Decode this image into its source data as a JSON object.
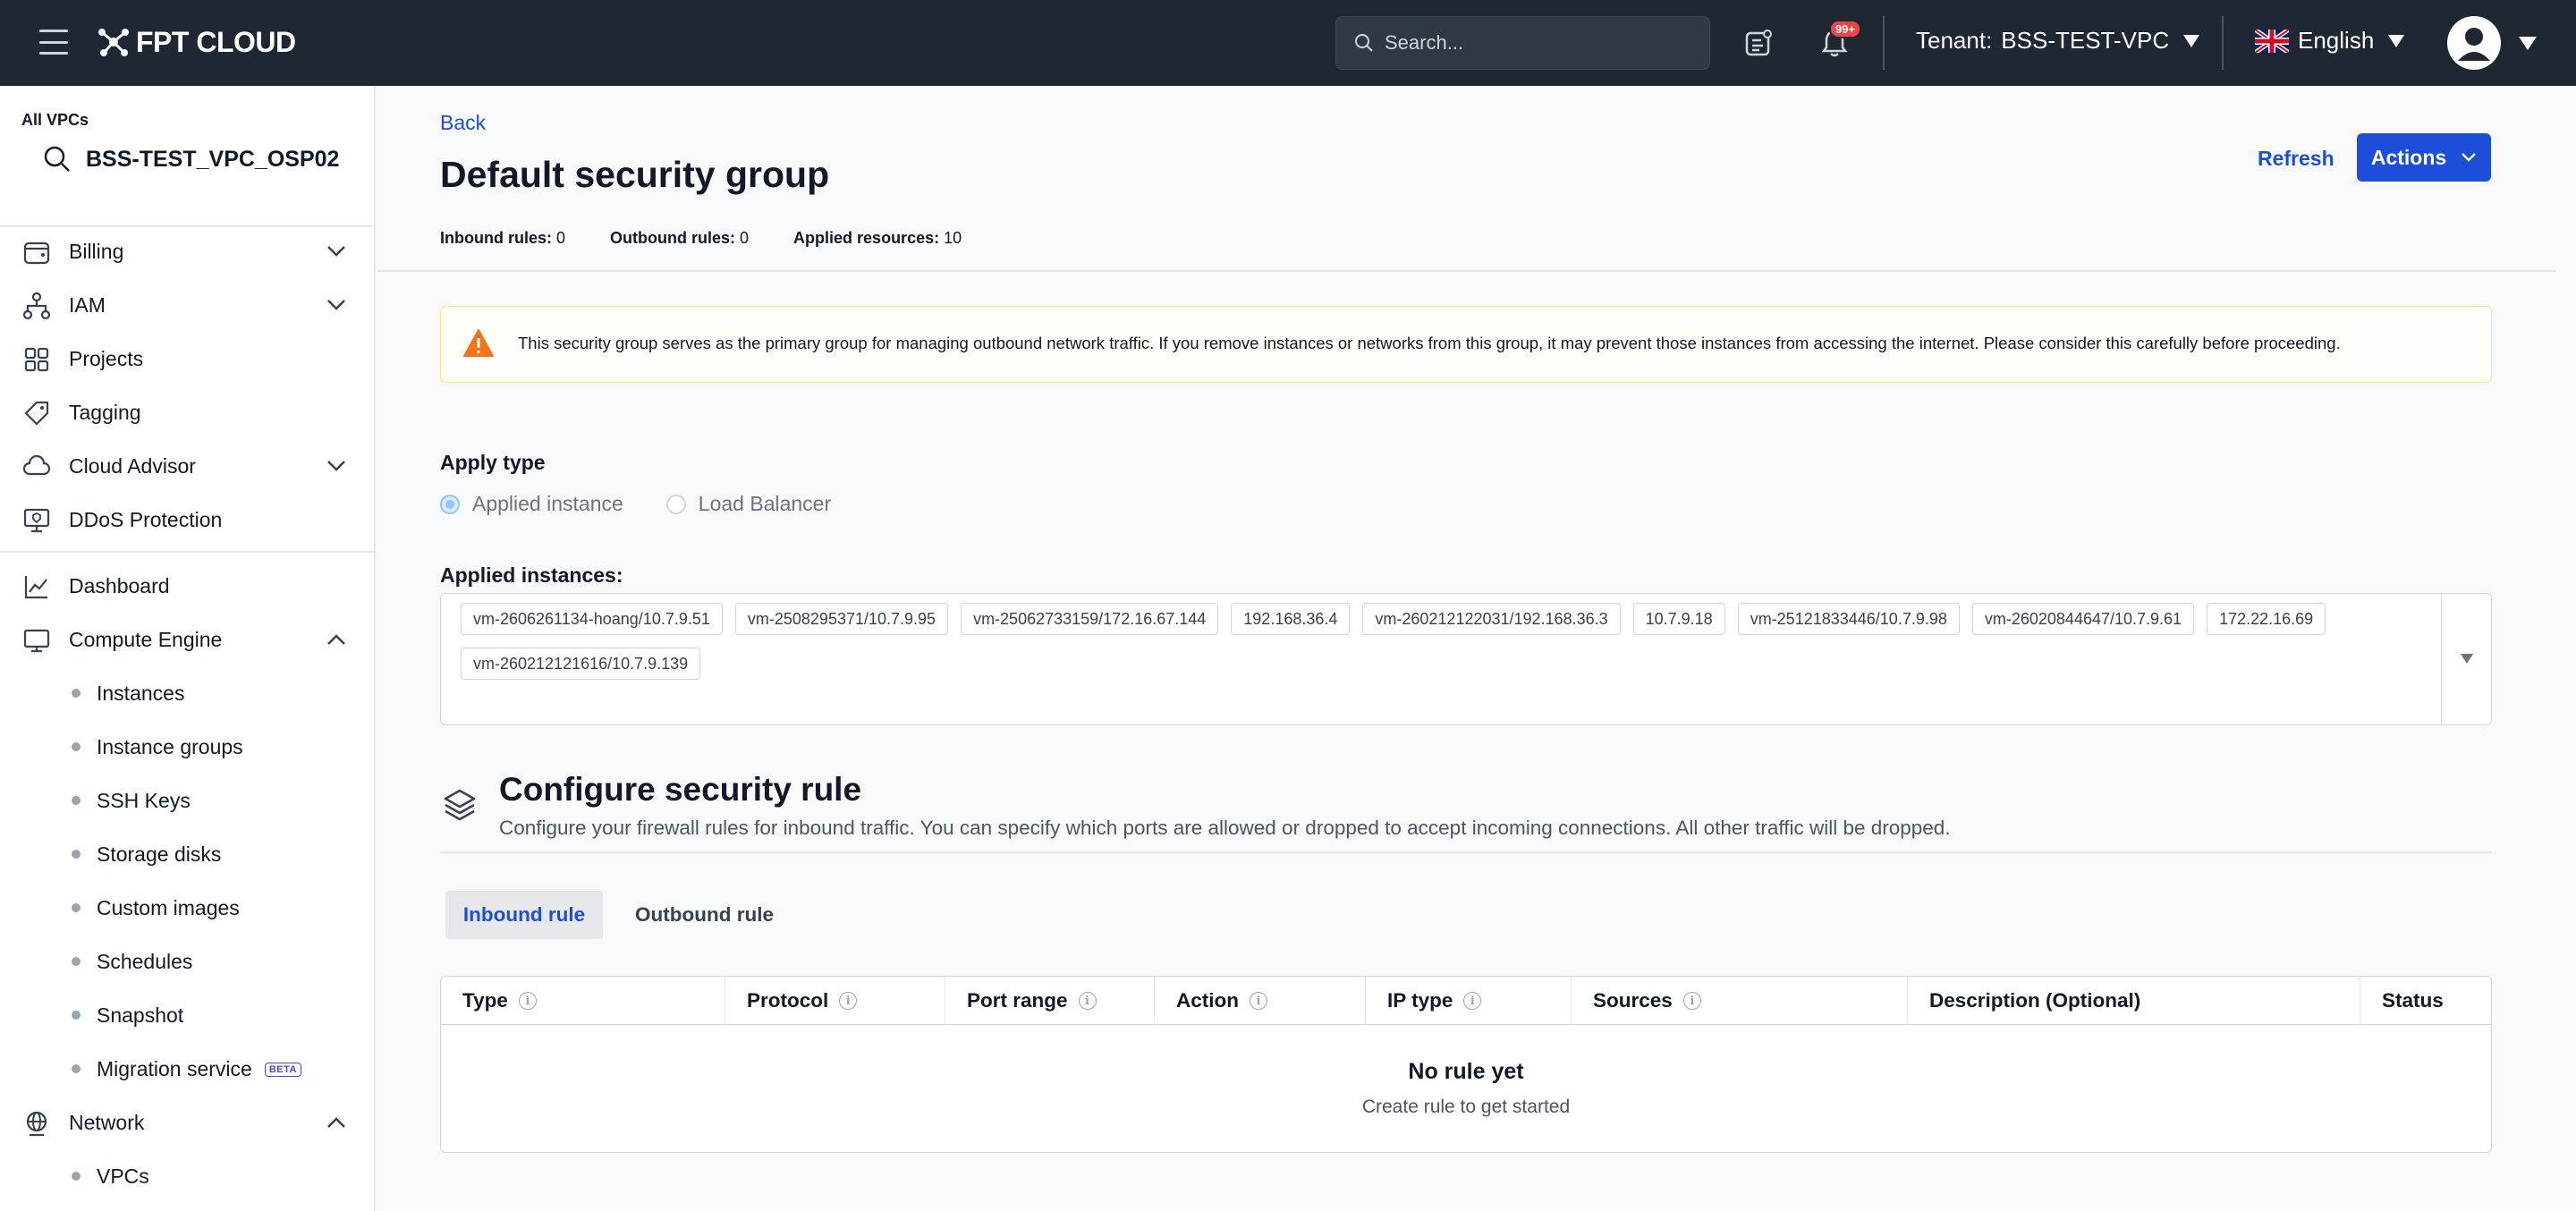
{
  "topbar": {
    "logo_text": "FPT CLOUD",
    "search_placeholder": "Search...",
    "notif_badge": "99+",
    "tenant_label": "Tenant:",
    "tenant_value": "BSS-TEST-VPC",
    "language": "English"
  },
  "sidebar": {
    "all_vpcs": "All VPCs",
    "vpc_name": "BSS-TEST_VPC_OSP02",
    "items": [
      {
        "label": "Billing"
      },
      {
        "label": "IAM"
      },
      {
        "label": "Projects"
      },
      {
        "label": "Tagging"
      },
      {
        "label": "Cloud Advisor"
      },
      {
        "label": "DDoS Protection"
      },
      {
        "label": "Dashboard"
      },
      {
        "label": "Compute Engine"
      },
      {
        "label": "Network"
      }
    ],
    "compute_sub": [
      {
        "label": "Instances"
      },
      {
        "label": "Instance groups"
      },
      {
        "label": "SSH Keys"
      },
      {
        "label": "Storage disks"
      },
      {
        "label": "Custom images"
      },
      {
        "label": "Schedules"
      },
      {
        "label": "Snapshot"
      },
      {
        "label": "Migration service"
      }
    ],
    "beta_label": "BETA",
    "network_sub": [
      {
        "label": "VPCs"
      }
    ]
  },
  "main": {
    "back": "Back",
    "title": "Default security group",
    "refresh": "Refresh",
    "actions": "Actions",
    "stats": {
      "inbound_label": "Inbound rules:",
      "inbound_value": "0",
      "outbound_label": "Outbound rules:",
      "outbound_value": "0",
      "applied_label": "Applied resources:",
      "applied_value": "10"
    },
    "warning": "This security group serves as the primary group for managing outbound network traffic. If you remove instances or networks from this group, it may prevent those instances from accessing the internet. Please consider this carefully before proceeding.",
    "apply_type_label": "Apply type",
    "apply_options": [
      "Applied instance",
      "Load Balancer"
    ],
    "applied_instances_label": "Applied instances:",
    "instances": [
      "vm-2606261134-hoang/10.7.9.51",
      "vm-2508295371/10.7.9.95",
      "vm-25062733159/172.16.67.144",
      "192.168.36.4",
      "vm-260212122031/192.168.36.3",
      "10.7.9.18",
      "vm-25121833446/10.7.9.98",
      "vm-26020844647/10.7.9.61",
      "172.22.16.69",
      "vm-260212121616/10.7.9.139"
    ],
    "configure_title": "Configure security rule",
    "configure_desc": "Configure your firewall rules for inbound traffic. You can specify which ports are allowed or dropped to accept incoming connections. All other traffic will be dropped.",
    "tabs": [
      "Inbound rule",
      "Outbound rule"
    ],
    "table_headers": [
      "Type",
      "Protocol",
      "Port range",
      "Action",
      "IP type",
      "Sources",
      "Description (Optional)",
      "Status"
    ],
    "empty_title": "No rule yet",
    "empty_sub": "Create rule to get started"
  },
  "colors": {
    "topbar_bg": "#1e2732",
    "accent": "#1d4ed8",
    "warning": "#f97316"
  }
}
